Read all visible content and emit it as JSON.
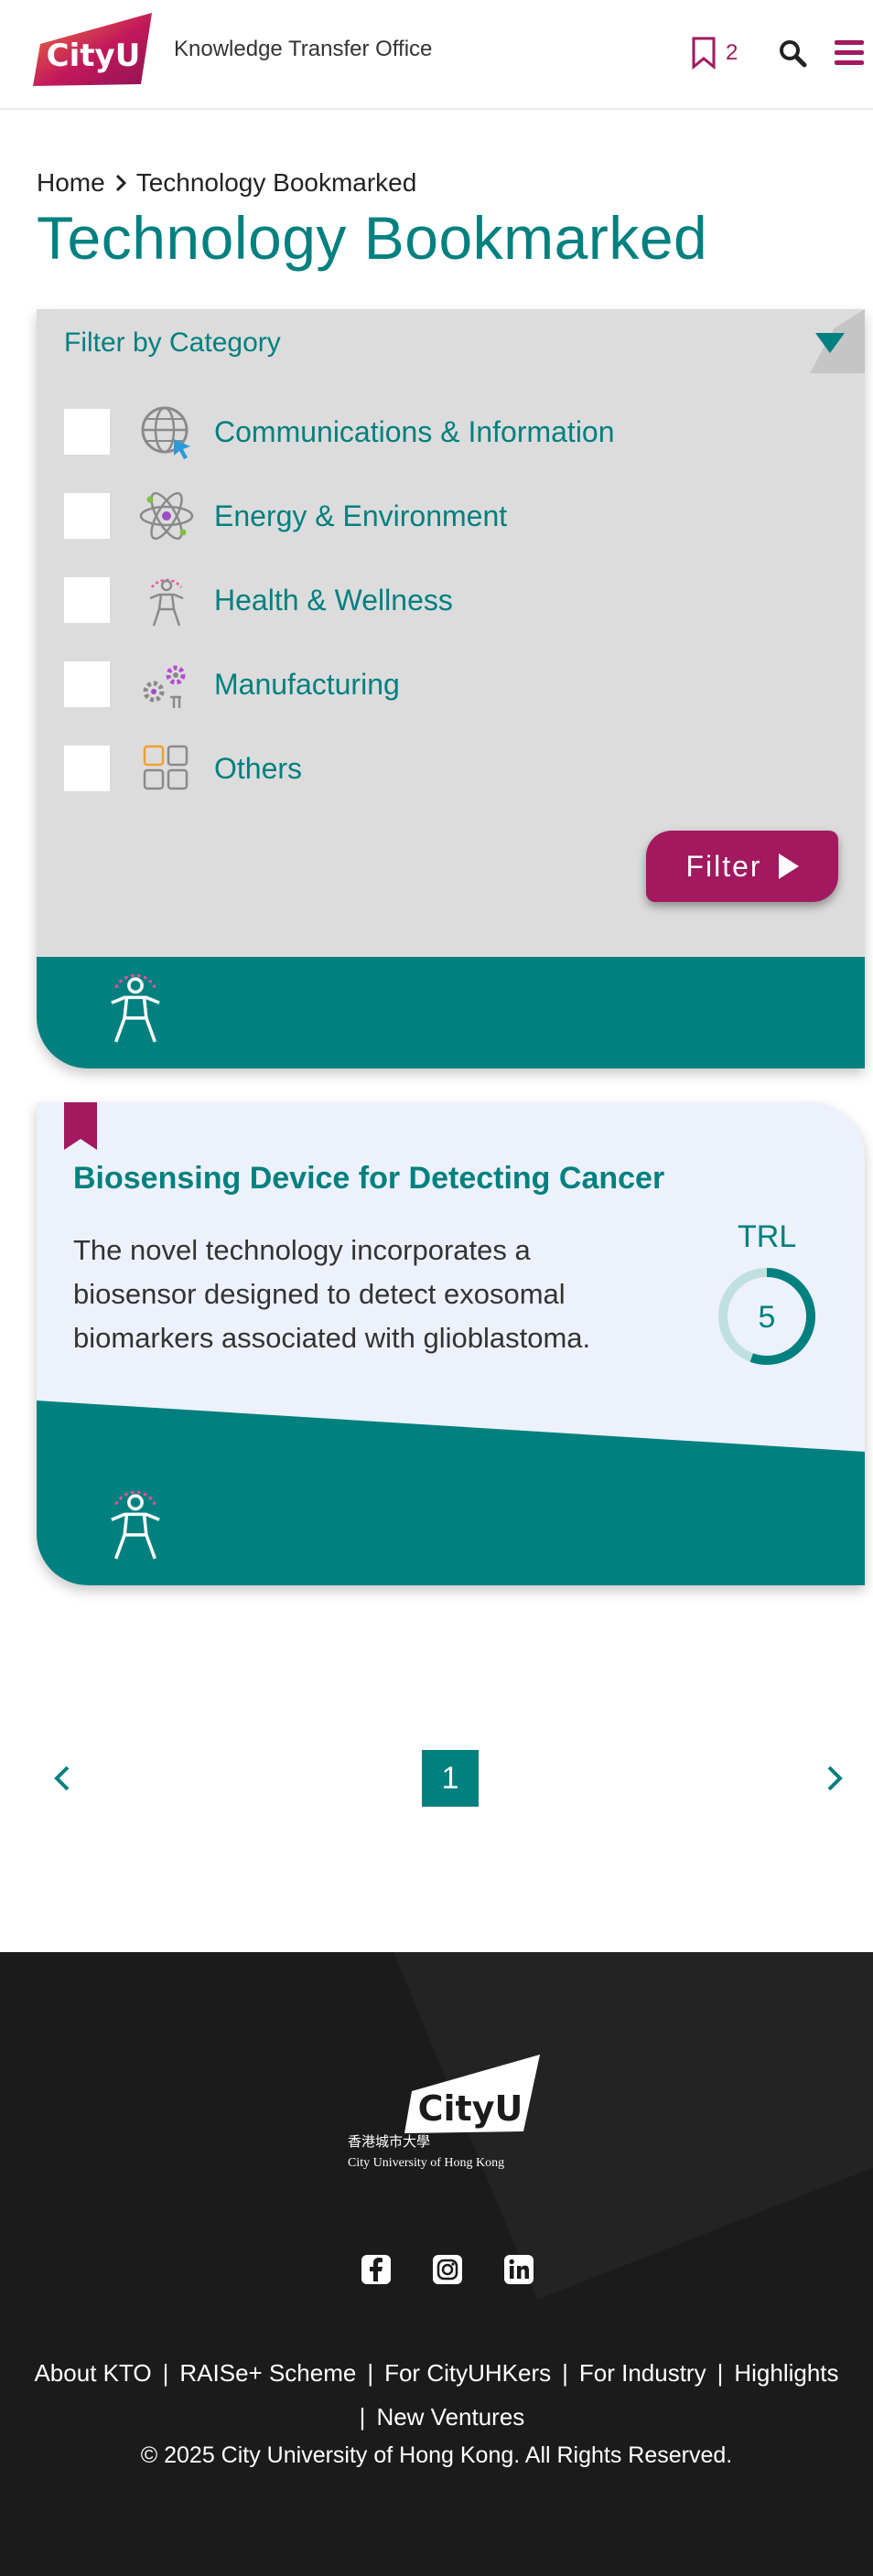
{
  "header": {
    "logo_text": "CityU",
    "site_title": "Knowledge Transfer Office",
    "bookmark_count": "2",
    "colors": {
      "brand": "#a2195f",
      "teal": "#00807f"
    },
    "icons": [
      "bookmark-icon",
      "search-icon",
      "menu-icon"
    ]
  },
  "breadcrumb": {
    "home": "Home",
    "current": "Technology Bookmarked"
  },
  "page_title": "Technology Bookmarked",
  "filter": {
    "header": "Filter by Category",
    "categories": [
      {
        "label": "Communications & Information",
        "icon": "globe-icon",
        "checked": false
      },
      {
        "label": "Energy & Environment",
        "icon": "atom-icon",
        "checked": false
      },
      {
        "label": "Health & Wellness",
        "icon": "health-person-icon",
        "checked": false
      },
      {
        "label": "Manufacturing",
        "icon": "gears-icon",
        "checked": false
      },
      {
        "label": "Others",
        "icon": "grid-icon",
        "checked": false
      }
    ],
    "button_label": "Filter"
  },
  "tech_card": {
    "title": "Biosensing Device for Detecting Cancer",
    "description": "The novel technology incorporates a biosensor designed to detect exosomal biomarkers associated with glioblastoma.",
    "trl_label": "TRL",
    "trl_value": "5",
    "trl_max": 9,
    "category_icon": "health-person-icon"
  },
  "pagination": {
    "current_page": "1"
  },
  "footer": {
    "logo_text": "CityU",
    "logo_chinese": "香港城市大學",
    "logo_english": "City University of Hong Kong",
    "social": [
      "facebook-icon",
      "instagram-icon",
      "linkedin-icon"
    ],
    "links": [
      "About KTO",
      "RAISe+ Scheme",
      "For CityUHKers",
      "For Industry",
      "Highlights",
      "New Ventures"
    ],
    "copyright": "© 2025 City University of Hong Kong. All Rights Reserved."
  }
}
